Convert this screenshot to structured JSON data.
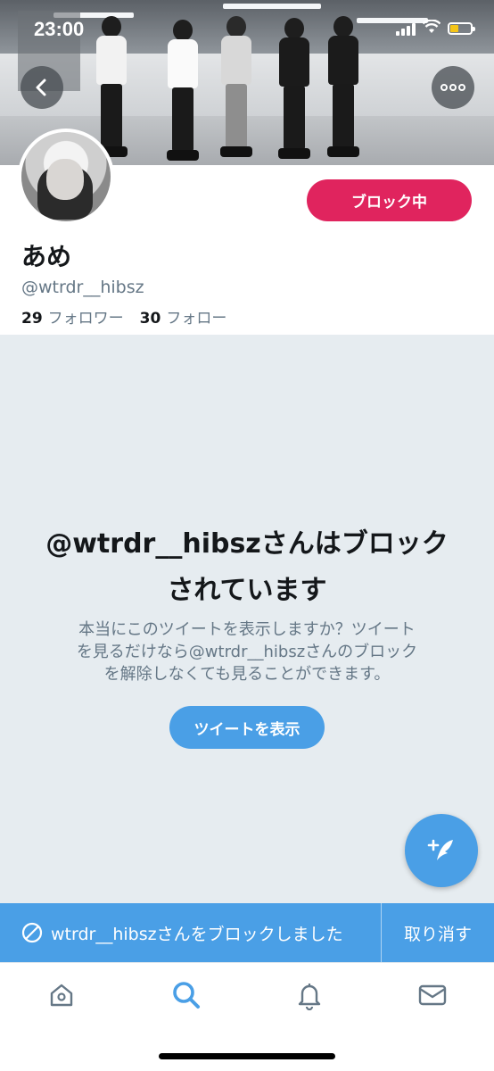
{
  "status_bar": {
    "time": "23:00",
    "battery_level": 0.4
  },
  "profile": {
    "display_name": "あめ",
    "handle": "@wtrdr__hibsz",
    "followers_count": "29",
    "followers_label": "フォロワー",
    "following_count": "30",
    "following_label": "フォロー",
    "block_button_label": "ブロック中"
  },
  "blocked_notice": {
    "title_line1": "@wtrdr__hibszさんはブロック",
    "title_line2": "されています",
    "description_line1": "本当にこのツイートを表示しますか？ツイート",
    "description_line2": "を見るだけなら@wtrdr__hibszさんのブロック",
    "description_line3": "を解除しなくても見ることができます。",
    "show_button_label": "ツイートを表示"
  },
  "toast": {
    "message": "wtrdr__hibszさんをブロックしました",
    "undo_label": "取り消す"
  },
  "tab_bar": {
    "tabs": [
      {
        "icon": "home-icon",
        "active": false
      },
      {
        "icon": "search-icon",
        "active": true
      },
      {
        "icon": "notifications-icon",
        "active": false
      },
      {
        "icon": "messages-icon",
        "active": false
      }
    ]
  },
  "colors": {
    "accent": "#4a9fe6",
    "block_red": "#e0245e",
    "muted_text": "#657786",
    "background_gray": "#e6ecf0"
  }
}
